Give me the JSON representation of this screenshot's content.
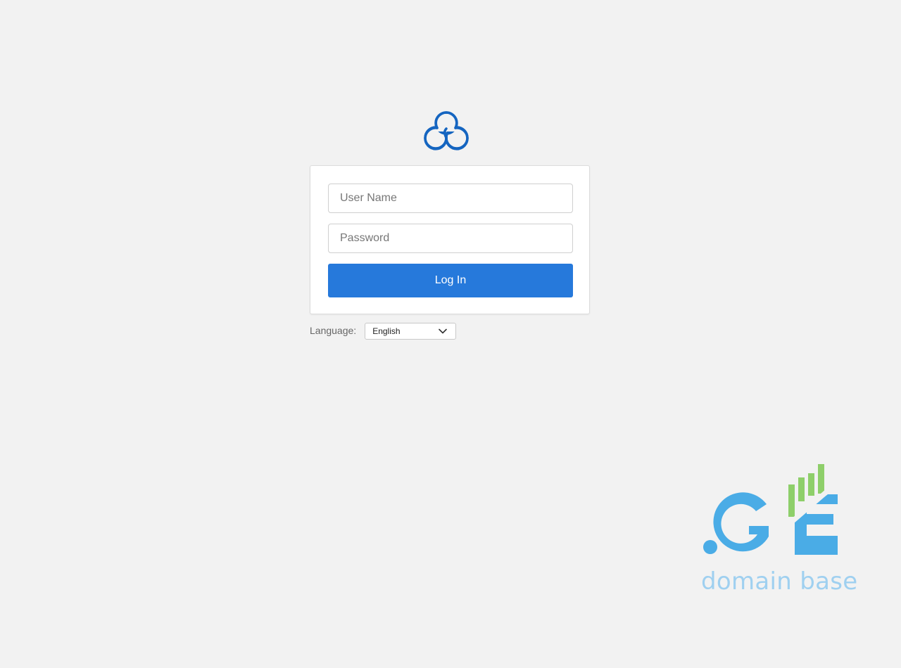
{
  "login": {
    "username_placeholder": "User Name",
    "password_placeholder": "Password",
    "submit_label": "Log In"
  },
  "language": {
    "label": "Language:",
    "selected": "English"
  },
  "brand": {
    "tagline": "domain base",
    "logo_text": ".GE"
  },
  "icons": {
    "app_logo": "cloud-icon",
    "dropdown": "chevron-down-icon"
  },
  "colors": {
    "background": "#f2f2f2",
    "accent": "#2679db",
    "logo_blue": "#1565c0",
    "brand_blue": "#4aace6",
    "brand_green": "#8ecf6a",
    "brand_text": "#9fd0f0"
  }
}
